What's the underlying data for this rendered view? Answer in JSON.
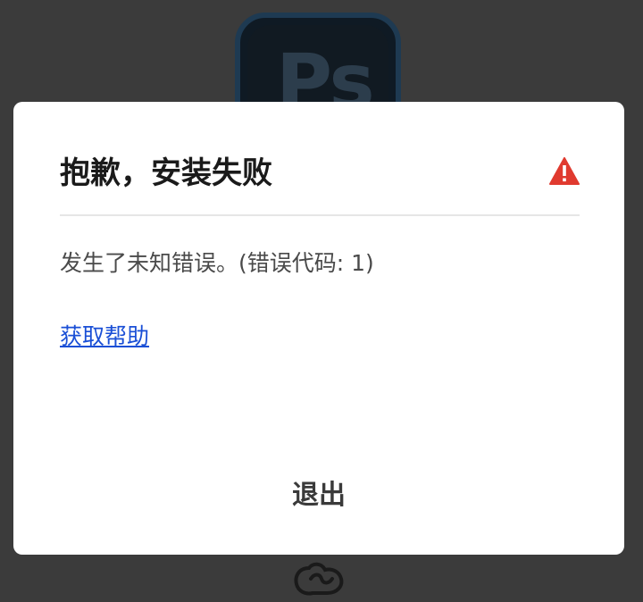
{
  "background_app": {
    "icon_letters": "Ps",
    "icon_name": "photoshop-app-icon"
  },
  "dialog": {
    "title": "抱歉，安装失败",
    "status_icon": "warning-icon",
    "status_color": "#e03a2f",
    "message": "发生了未知错误。(错误代码: 1)",
    "help_link": "获取帮助",
    "exit_button": "退出"
  },
  "footer": {
    "logo_name": "creative-cloud-logo-icon"
  }
}
